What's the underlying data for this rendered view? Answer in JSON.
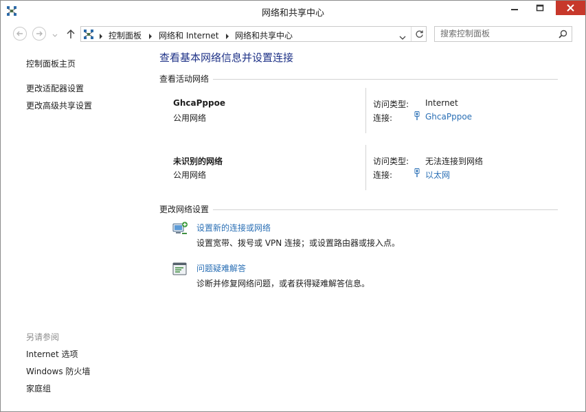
{
  "window": {
    "title": "网络和共享中心"
  },
  "address_bar": {
    "crumbs": [
      "控制面板",
      "网络和 Internet",
      "网络和共享中心"
    ]
  },
  "search": {
    "placeholder": "搜索控制面板"
  },
  "sidebar": {
    "home": "控制面板主页",
    "links": [
      "更改适配器设置",
      "更改高级共享设置"
    ],
    "see_also_heading": "另请参阅",
    "see_also": [
      "Internet 选项",
      "Windows 防火墙",
      "家庭组"
    ]
  },
  "main": {
    "title": "查看基本网络信息并设置连接",
    "active_networks_label": "查看活动网络",
    "networks": [
      {
        "name": "GhcaPppoe",
        "type": "公用网络",
        "access_label": "访问类型:",
        "access_value": "Internet",
        "connection_label": "连接:",
        "connection_value": "GhcaPppoe"
      },
      {
        "name": "未识别的网络",
        "type": "公用网络",
        "access_label": "访问类型:",
        "access_value": "无法连接到网络",
        "connection_label": "连接:",
        "connection_value": "以太网"
      }
    ],
    "change_settings_label": "更改网络设置",
    "tasks": [
      {
        "link": "设置新的连接或网络",
        "description": "设置宽带、拨号或 VPN 连接；或设置路由器或接入点。"
      },
      {
        "link": "问题疑难解答",
        "description": "诊断并修复网络问题，或者获得疑难解答信息。"
      }
    ]
  },
  "colors": {
    "title_blue": "#1e3287",
    "link_blue": "#2a6fb5",
    "close_red": "#c7382b",
    "muted_gray": "#8c8c8c"
  },
  "icons": {
    "app": "network-icon",
    "back": "back-arrow-icon",
    "forward": "forward-arrow-icon",
    "up": "up-arrow-icon",
    "refresh": "refresh-icon",
    "search": "search-icon",
    "connection": "ethernet-plug-icon",
    "new_connection": "network-setup-icon",
    "troubleshoot": "troubleshoot-icon"
  }
}
